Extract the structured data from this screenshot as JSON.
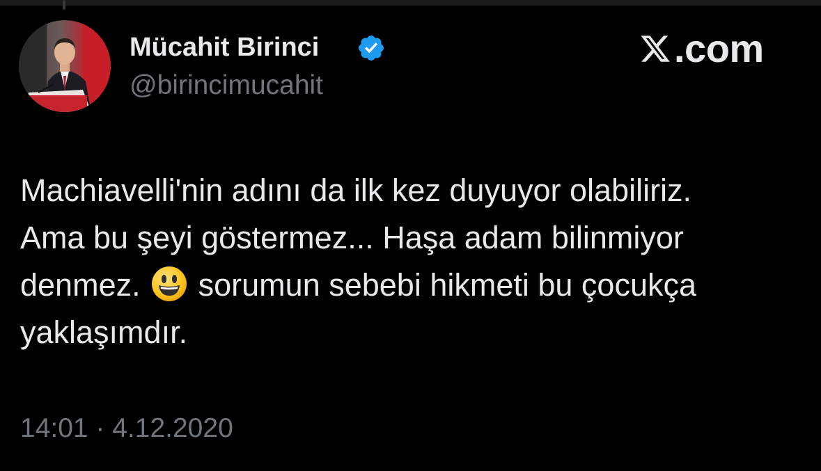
{
  "author": {
    "name": "Mücahit Birinci",
    "handle": "@birincimucahit",
    "verified": true,
    "avatar_icon": "profile-photo"
  },
  "brand": {
    "text": ".com",
    "icon": "x-logo-icon"
  },
  "tweet": {
    "lines": {
      "line1": "Machiavelli'nin adını da ilk kez duyuyor olabiliriz.",
      "line2": "Ama bu şeyi göstermez... Haşa adam bilinmiyor",
      "line3_before_emoji": "denmez.",
      "line3_after_emoji": "sorumun sebebi hikmeti bu çocukça",
      "line4": "yaklaşımdır."
    },
    "emoji": "smiling-face-emoji"
  },
  "meta": {
    "timestamp": "14:01 · 4.12.2020"
  },
  "colors": {
    "background": "#000000",
    "text_primary": "#e7e9ea",
    "text_secondary": "#71767b",
    "verified_blue": "#1d9bf0"
  }
}
